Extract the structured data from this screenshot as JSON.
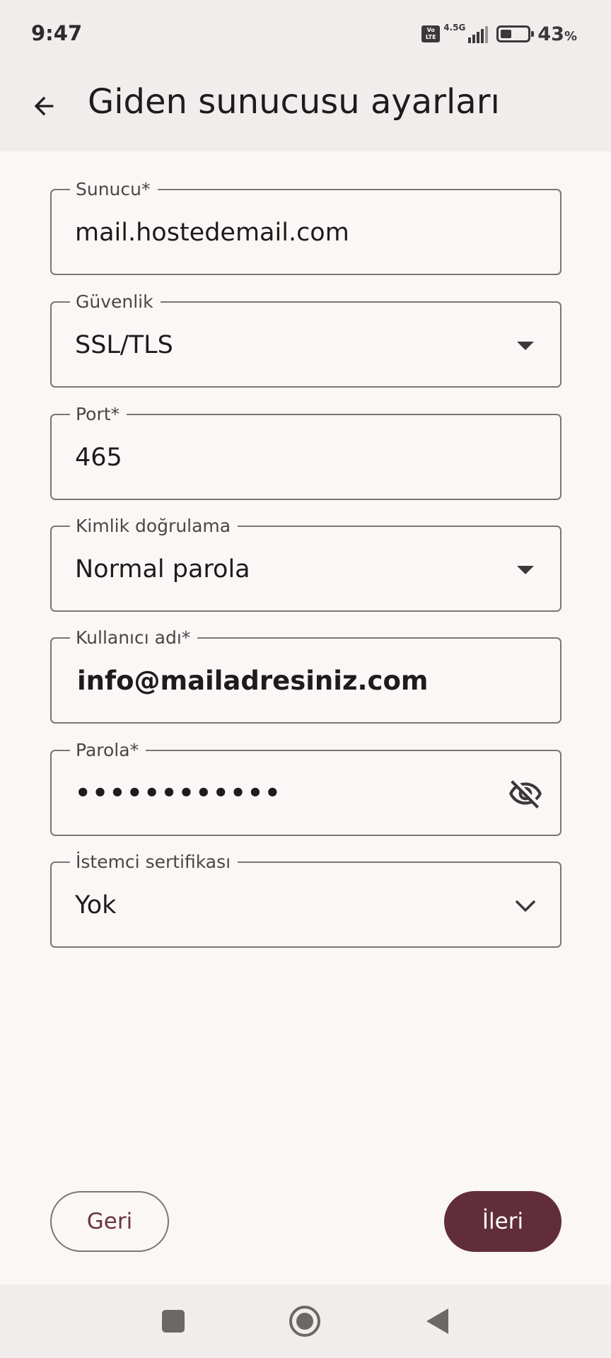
{
  "status_bar": {
    "time": "9:47",
    "volte": "Vo LTE",
    "network": "4.5G",
    "battery_percent": "43",
    "battery_unit": "%",
    "battery_level": 0.43,
    "icons": [
      "volte-icon",
      "signal-icon",
      "battery-icon"
    ]
  },
  "app_bar": {
    "title": "Giden sunucusu ayarları",
    "back_icon": "arrow-left-icon"
  },
  "form": {
    "server": {
      "label": "Sunucu*",
      "value": "mail.hostedemail.com"
    },
    "security": {
      "label": "Güvenlik",
      "value": "SSL/TLS",
      "icon": "dropdown-triangle-icon"
    },
    "port": {
      "label": "Port*",
      "value": "465"
    },
    "authentication": {
      "label": "Kimlik doğrulama",
      "value": "Normal parola",
      "icon": "dropdown-triangle-icon"
    },
    "username": {
      "label": "Kullanıcı adı*",
      "value": "info@mailadresiniz.com"
    },
    "password": {
      "label": "Parola*",
      "value": "••••••••••••",
      "icon": "visibility-off-icon"
    },
    "client_certificate": {
      "label": "İstemci sertifikası",
      "value": "Yok",
      "icon": "chevron-down-icon"
    }
  },
  "buttons": {
    "back_label": "Geri",
    "next_label": "İleri"
  },
  "colors": {
    "primary": "#612d3b",
    "back_text": "#6a3444",
    "surface": "#faf7f6",
    "bar": "#f0edec",
    "outline": "#7b7676"
  },
  "nav_bar": {
    "icons": [
      "recents-square-icon",
      "home-circle-icon",
      "back-triangle-icon"
    ]
  }
}
